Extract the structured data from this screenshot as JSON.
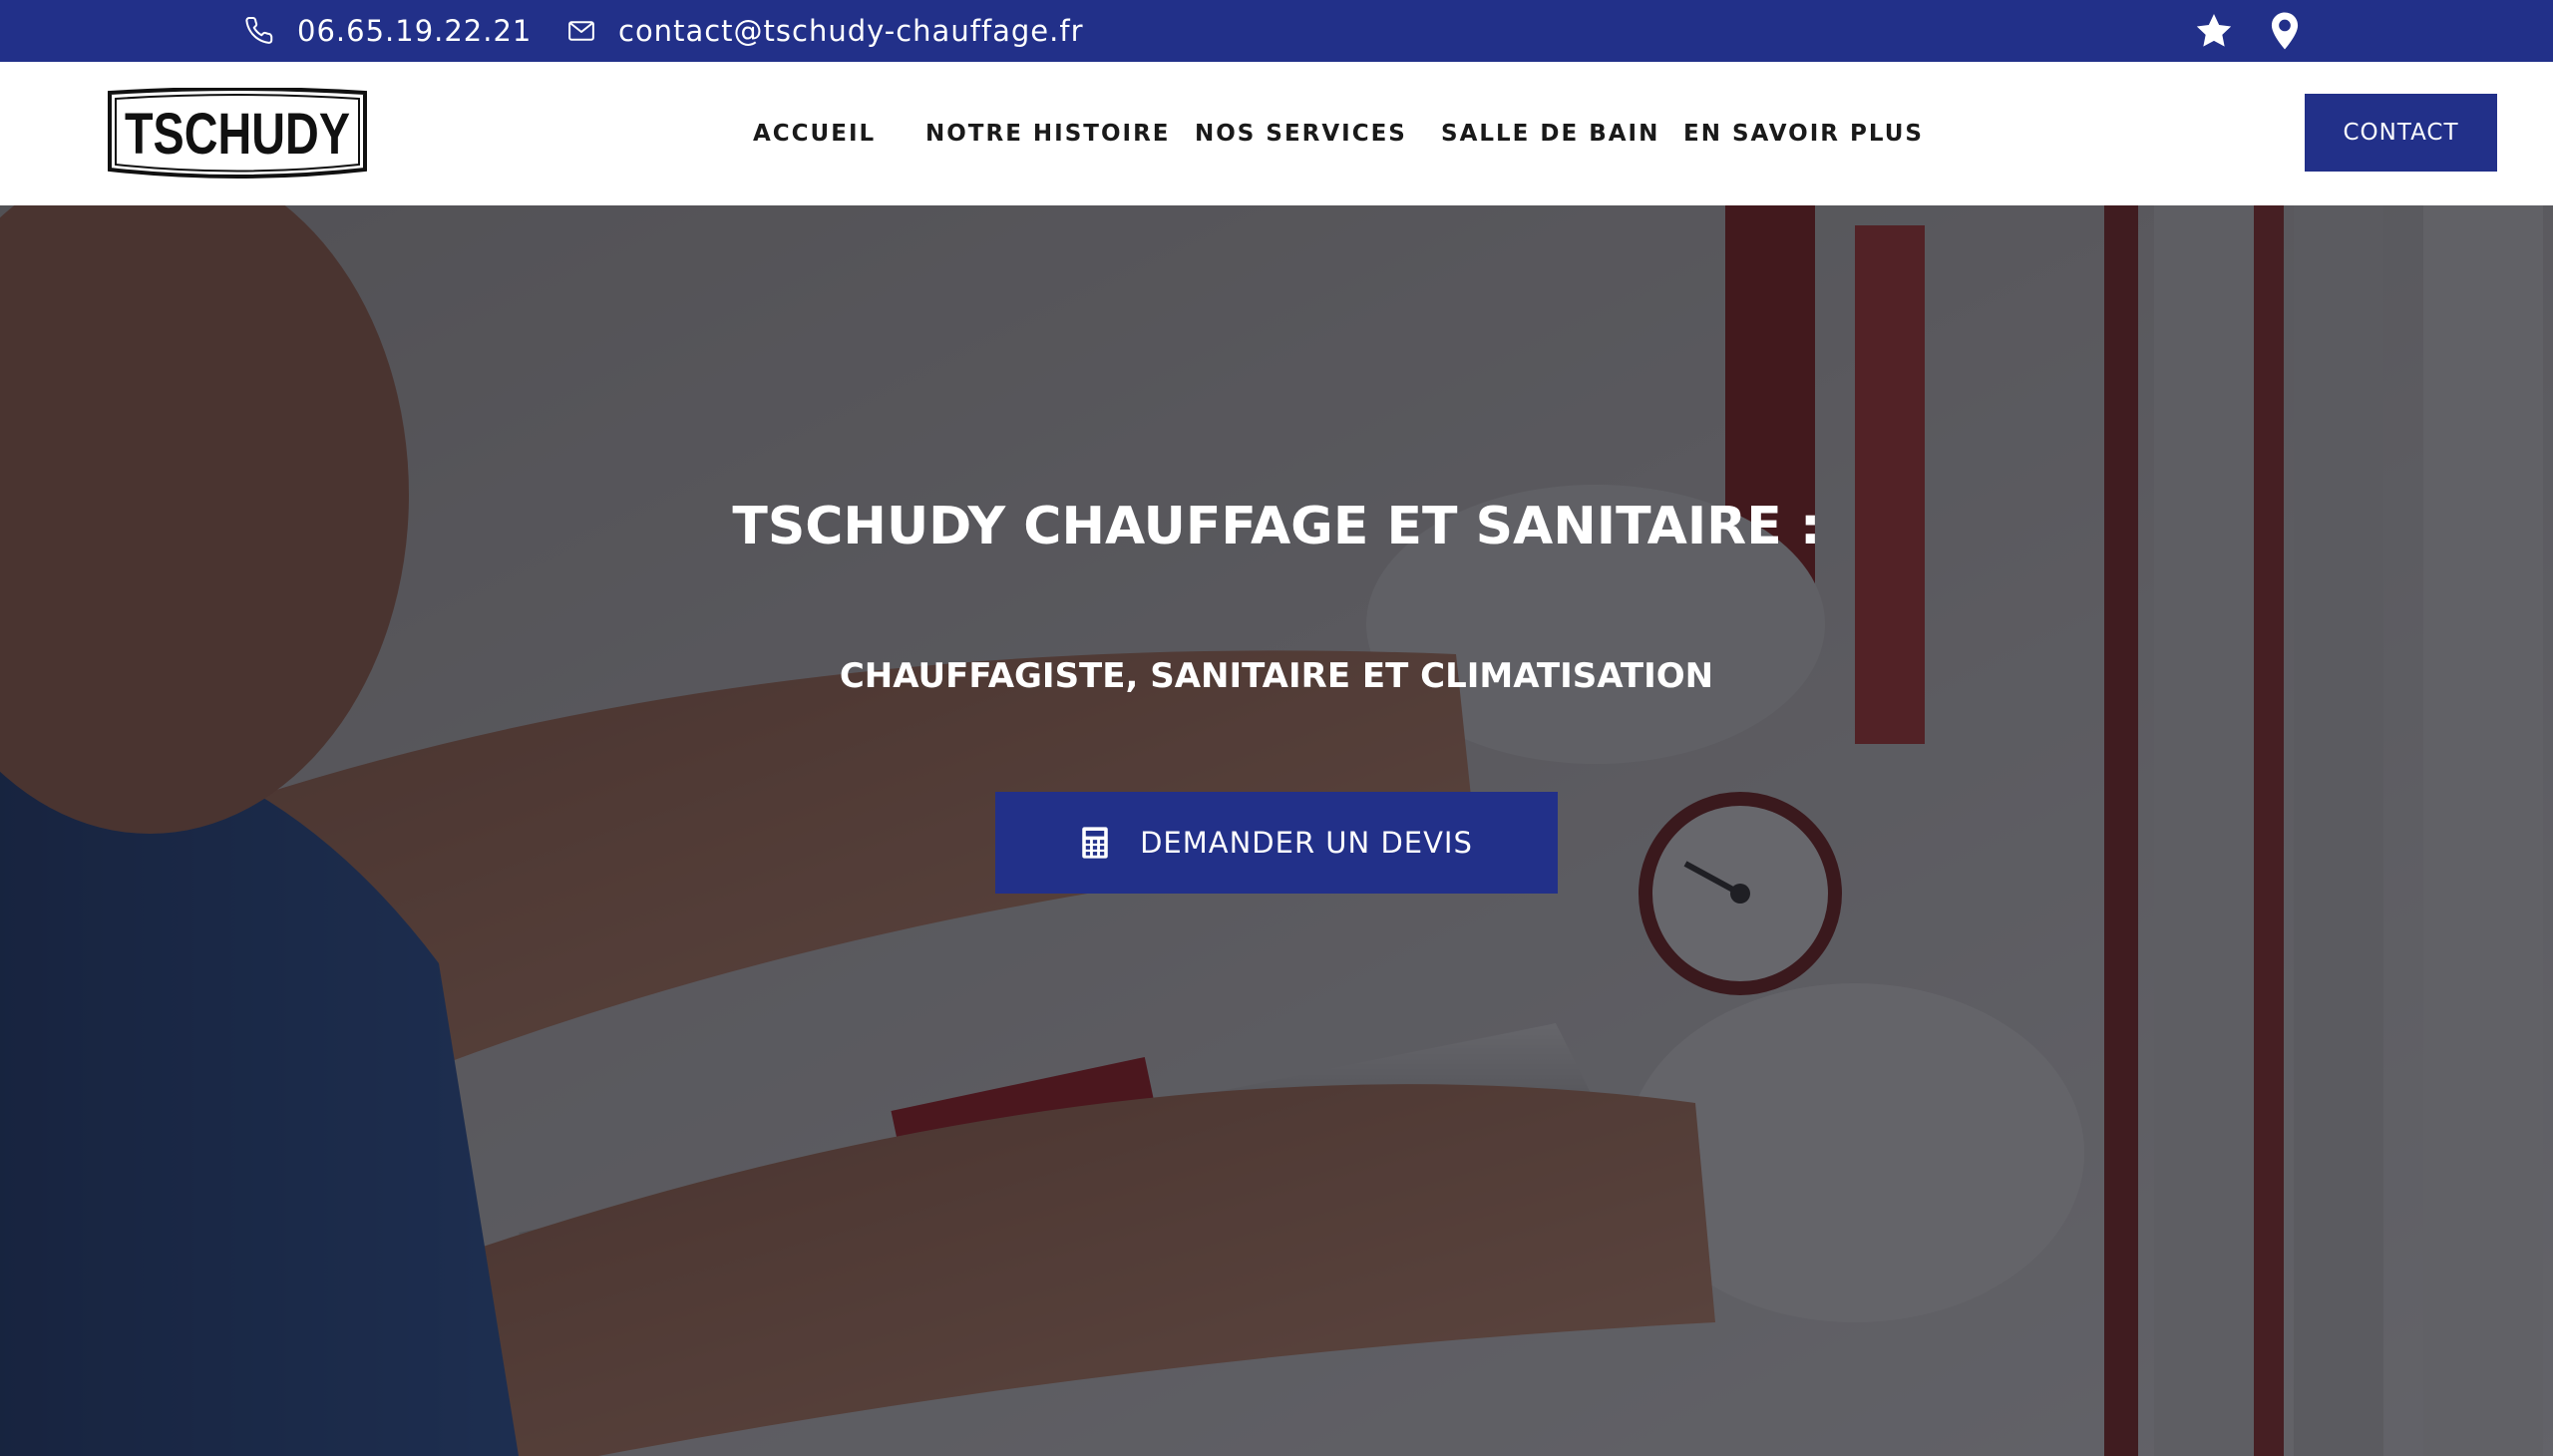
{
  "topbar": {
    "phone": "06.65.19.22.21",
    "email": "contact@tschudy-chauffage.fr",
    "icons": [
      "phone-icon",
      "mail-icon",
      "star-icon",
      "map-pin-icon"
    ],
    "background": "#223089"
  },
  "header": {
    "logo_text": "TSCHUDY",
    "nav": [
      {
        "label": "ACCUEIL"
      },
      {
        "label": "NOTRE HISTOIRE"
      },
      {
        "label": "NOS SERVICES"
      },
      {
        "label": "SALLE DE BAIN"
      },
      {
        "label": "EN SAVOIR PLUS"
      }
    ],
    "contact_label": "CONTACT"
  },
  "hero": {
    "title": "TSCHUDY CHAUFFAGE ET SANITAIRE :",
    "subtitle": "CHAUFFAGISTE, SANITAIRE ET CLIMATISATION",
    "cta_label": "DEMANDER UN DEVIS",
    "cta_icon": "calculator-icon"
  },
  "colors": {
    "brand": "#223089",
    "text_dark": "#1a1a1a",
    "white": "#ffffff"
  }
}
